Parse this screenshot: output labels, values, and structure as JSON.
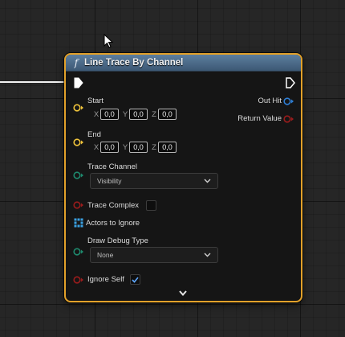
{
  "node": {
    "title": "Line Trace By Channel",
    "icon": "function-icon",
    "header_color": "#4a6888",
    "border_color": "#e2a12a"
  },
  "inputs": {
    "start": {
      "label": "Start",
      "x_axis": "X",
      "x": "0,0",
      "y_axis": "Y",
      "y": "0,0",
      "z_axis": "Z",
      "z": "0,0",
      "pin_color": "#f0c43b"
    },
    "end": {
      "label": "End",
      "x_axis": "X",
      "x": "0,0",
      "y_axis": "Y",
      "y": "0,0",
      "z_axis": "Z",
      "z": "0,0",
      "pin_color": "#f0c43b"
    },
    "trace_channel": {
      "label": "Trace Channel",
      "value": "Visibility",
      "pin_color": "#1e8a6e"
    },
    "trace_complex": {
      "label": "Trace Complex",
      "checked": false,
      "pin_color": "#9b1c1c"
    },
    "actors_to_ignore": {
      "label": "Actors to Ignore",
      "pin_color": "#3aa0e0"
    },
    "draw_debug_type": {
      "label": "Draw Debug Type",
      "value": "None",
      "pin_color": "#1e8a6e"
    },
    "ignore_self": {
      "label": "Ignore Self",
      "checked": true,
      "pin_color": "#9b1c1c"
    }
  },
  "outputs": {
    "out_hit": {
      "label": "Out Hit",
      "pin_color": "#2f7fd6"
    },
    "return_value": {
      "label": "Return Value",
      "pin_color": "#9b1c1c"
    }
  }
}
